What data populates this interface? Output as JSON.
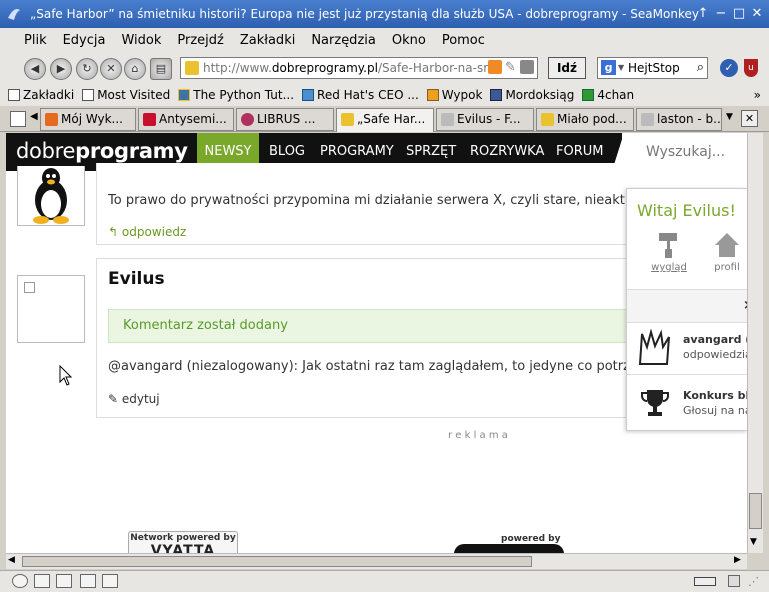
{
  "window": {
    "title": "„Safe Harbor” na śmietniku historii? Europa nie jest już przystanią dla służb USA - dobreprogramy - SeaMonkey"
  },
  "menu": [
    "Plik",
    "Edycja",
    "Widok",
    "Przejdź",
    "Zakładki",
    "Narzędzia",
    "Okno",
    "Pomoc"
  ],
  "navbar": {
    "url_prefix": "http://www.",
    "url_domain": "dobreprogramy.pl",
    "url_path": "/Safe-Harbor-na-smi",
    "go_label": "Idź",
    "search_value": "HejtStop"
  },
  "bookmarks": [
    "Zakładki",
    "Most Visited",
    "The Python Tut...",
    "Red Hat's CEO ...",
    "Wypok",
    "Mordoksiąg",
    "4chan"
  ],
  "tabs": [
    "Mój Wyk...",
    "Antysemi...",
    "LIBRUS ...",
    "„Safe Har...",
    "Evilus - F...",
    "Miało pod...",
    "laston - b..."
  ],
  "site": {
    "logo_light": "dobre",
    "logo_bold": "programy",
    "nav": [
      "NEWSY",
      "BLOG",
      "PROGRAMY",
      "SPRZĘT",
      "ROZRYWKA",
      "FORUM"
    ],
    "search_placeholder": "Wyszukaj..."
  },
  "comments": {
    "first_text": "To prawo do prywatności przypomina mi działanie serwera X, czyli stare, nieaktualne",
    "reply_label": "odpowiedz",
    "author": "Evilus",
    "added_notice": "Komentarz został dodany",
    "second_text": "@avangard (niezalogowany): Jak ostatni raz tam zaglądałem, to jedyne co potrzebne",
    "edit_label": "edytuj"
  },
  "ad_label": "r e k l a m a",
  "footer": {
    "network_powered": "Network powered by",
    "vyatta": "VYATTA",
    "powered_by": "powered by"
  },
  "panel": {
    "greeting": "Witaj Evilus!",
    "look_label": "wygląd",
    "profile_label": "profil",
    "notif1_title": "avangard (ni",
    "notif1_sub": "odpowiedzia",
    "notif2_title": "Konkurs blo",
    "notif2_sub": "Głosuj na na"
  },
  "colors": {
    "accent": "#7aa82a",
    "titlebar": "#2e5fb0",
    "notice_bg": "#eaf5e2"
  }
}
